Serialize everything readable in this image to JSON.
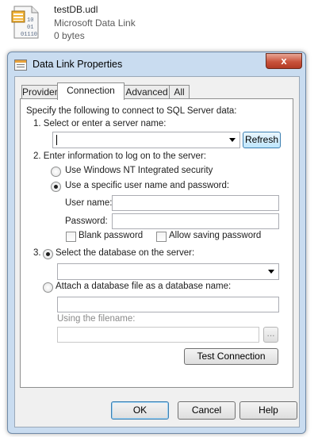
{
  "file": {
    "name": "testDB.udl",
    "type": "Microsoft Data Link",
    "size": "0 bytes",
    "icon": "udl-file-icon",
    "icon_text": [
      "10",
      "01",
      "01110"
    ]
  },
  "window": {
    "title": "Data Link Properties",
    "close_label": "x"
  },
  "tabs": [
    {
      "label": "Provider",
      "active": false
    },
    {
      "label": "Connection",
      "active": true
    },
    {
      "label": "Advanced",
      "active": false
    },
    {
      "label": "All",
      "active": false
    }
  ],
  "connection": {
    "intro": "Specify the following to connect to SQL Server data:",
    "step1": "1. Select or enter a server name:",
    "server_value": "",
    "refresh_label": "Refresh",
    "step2": "2. Enter information to log on to the server:",
    "opt_windows": "Use Windows NT Integrated security",
    "opt_specific": "Use a specific user name and password:",
    "username_label": "User name:",
    "username_value": "",
    "password_label": "Password:",
    "password_value": "",
    "blank_password": "Blank password",
    "allow_saving": "Allow saving password",
    "step3": "3.",
    "opt_select_db": "Select the database on the server:",
    "db_value": "",
    "opt_attach": "Attach a database file as a database name:",
    "attach_value": "",
    "using_filename": "Using the filename:",
    "filename_value": "",
    "browse_label": "...",
    "test_label": "Test Connection"
  },
  "footer": {
    "ok": "OK",
    "cancel": "Cancel",
    "help": "Help"
  },
  "colors": {
    "frame": "#c9dcf0",
    "close": "#c9533c",
    "accent": "#3c7fb1"
  }
}
